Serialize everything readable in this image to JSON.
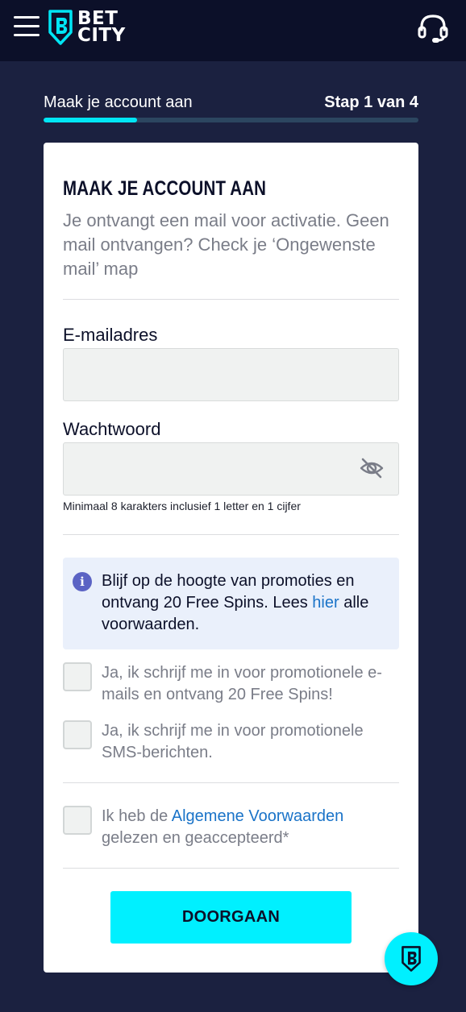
{
  "header": {
    "menu_icon": "hamburger-menu-icon",
    "logo_line1": "BET",
    "logo_line2": "CITY",
    "support_icon": "headset-icon"
  },
  "steps": {
    "label": "Maak je account aan",
    "count": "Stap 1 van 4",
    "progress": 0.25,
    "accent": "#00e6f5"
  },
  "form": {
    "title": "MAAK JE ACCOUNT AAN",
    "description": "Je ontvangt een mail voor activatie. Geen mail ontvangen? Check je ‘Ongewenste mail’ map",
    "email": {
      "label": "E-mailadres",
      "value": ""
    },
    "password": {
      "label": "Wachtwoord",
      "value": "",
      "hint": "Minimaal 8 karakters inclusief 1 letter en 1 cijfer",
      "toggle_icon": "eye-slash-icon"
    },
    "info": {
      "icon": "info-icon",
      "text_before": "Blijf op de hoogte van promoties en ontvang 20 Free Spins. Lees ",
      "link": "hier",
      "text_after": " alle voorwaarden."
    },
    "consents": [
      {
        "text": "Ja, ik schrijf me in voor promotionele e-mails en ontvang 20 Free Spins!",
        "checked": false
      },
      {
        "text": "Ja, ik schrijf me in voor promotionele SMS-berichten.",
        "checked": false
      }
    ],
    "terms": {
      "before": "Ik heb de ",
      "link": "Algemene Voorwaarden",
      "after": " gelezen en geaccepteerd*",
      "checked": false
    },
    "submit_label": "DOORGAAN"
  },
  "fab_icon": "betcity-shield-icon",
  "colors": {
    "background": "#1b2140",
    "topbar": "#0c1029",
    "cta": "#00f0ff",
    "link": "#1a73c8"
  }
}
